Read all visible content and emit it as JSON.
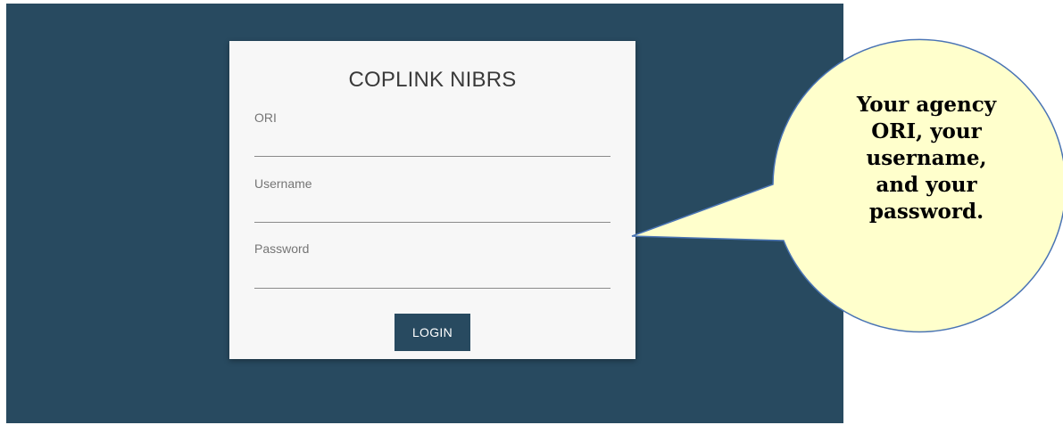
{
  "login": {
    "title": "COPLINK NIBRS",
    "fields": [
      {
        "label": "ORI",
        "value": ""
      },
      {
        "label": "Username",
        "value": ""
      },
      {
        "label": "Password",
        "value": ""
      }
    ],
    "button_label": "LOGIN"
  },
  "callout": {
    "lines": [
      "Your agency",
      "ORI, your",
      "username,",
      "and your",
      "password."
    ]
  },
  "colors": {
    "backdrop": "#284a60",
    "card": "#f7f7f7",
    "button": "#284a60",
    "callout_fill": "#ffffcc",
    "callout_stroke": "#4a74b4"
  }
}
